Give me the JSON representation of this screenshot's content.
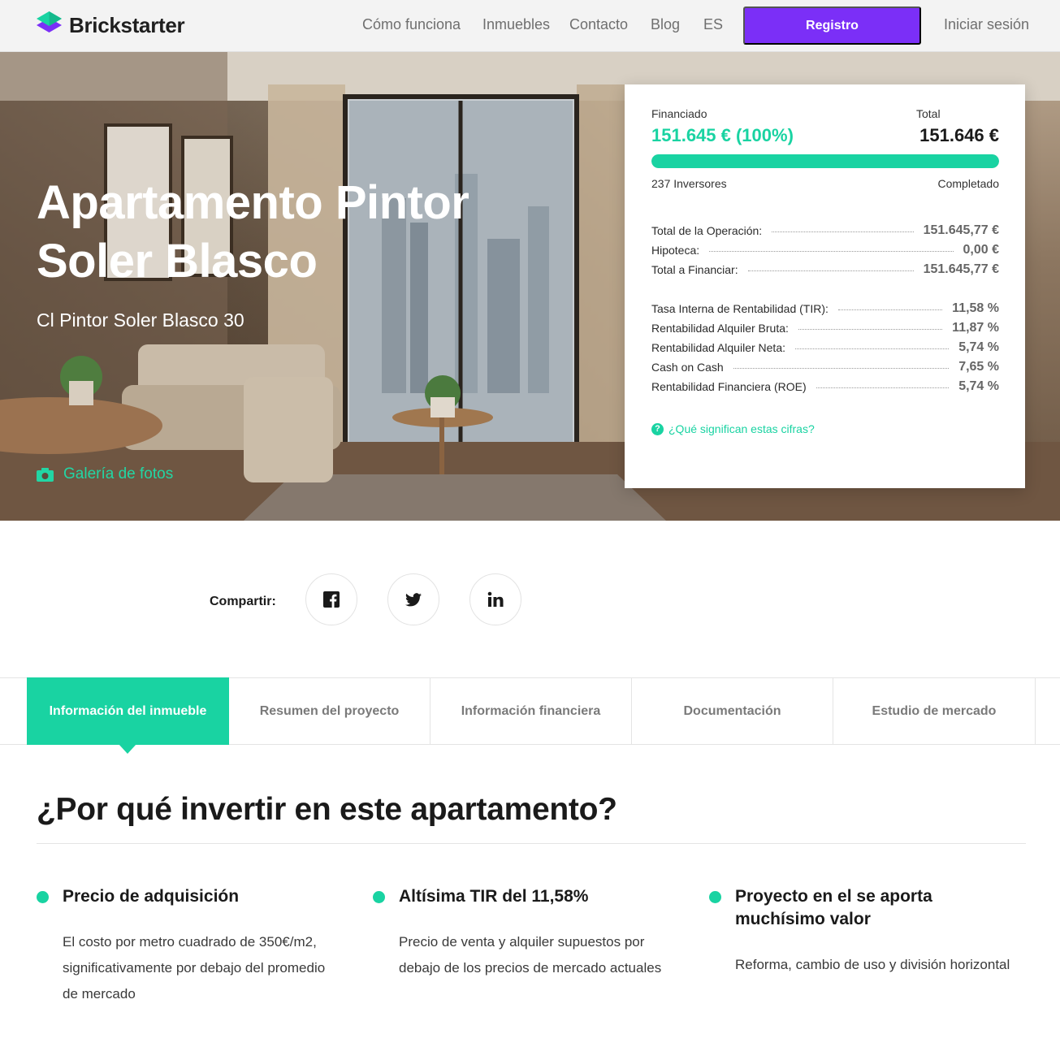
{
  "brand": {
    "name": "Brickstarter",
    "accent": "#19d3a2",
    "cta": "#7b2ff7"
  },
  "nav": {
    "items": [
      "Cómo funciona",
      "Inmuebles",
      "Contacto",
      "Blog",
      "ES"
    ],
    "register": "Registro",
    "login": "Iniciar sesión"
  },
  "hero": {
    "title": "Apartamento Pintor Soler Blasco",
    "address": "Cl Pintor Soler Blasco 30",
    "gallery": "Galería de fotos"
  },
  "funding": {
    "funded_label": "Financiado",
    "funded_value": "151.645 € (100%)",
    "total_label": "Total",
    "total_value": "151.646 €",
    "progress_fraction": 1.0,
    "investors": "237 Inversores",
    "status": "Completado",
    "operation_rows": [
      {
        "label": "Total de la Operación:",
        "value": "151.645,77 €"
      },
      {
        "label": "Hipoteca:",
        "value": "0,00 €"
      },
      {
        "label": "Total a Financiar:",
        "value": "151.645,77 €"
      }
    ],
    "return_rows": [
      {
        "label": "Tasa Interna de Rentabilidad (TIR):",
        "value": "11,58 %"
      },
      {
        "label": "Rentabilidad Alquiler Bruta:",
        "value": "11,87 %"
      },
      {
        "label": "Rentabilidad Alquiler Neta:",
        "value": "5,74 %"
      },
      {
        "label": "Cash on Cash",
        "value": "7,65 %"
      },
      {
        "label": "Rentabilidad Financiera (ROE)",
        "value": "5,74 %"
      }
    ],
    "help_icon": "?",
    "help_link": "¿Qué significan estas cifras?"
  },
  "share": {
    "label": "Compartir:",
    "icons": [
      "facebook-icon",
      "twitter-icon",
      "linkedin-icon"
    ]
  },
  "tabs": [
    "Información del inmueble",
    "Resumen del proyecto",
    "Información financiera",
    "Documentación",
    "Estudio de mercado"
  ],
  "why": {
    "title": "¿Por qué invertir en este apartamento?",
    "features": [
      {
        "title": "Precio de adquisición",
        "text": "El costo por metro cuadrado de 350€/m2, significativamente por debajo del promedio de mercado"
      },
      {
        "title": "Altísima TIR del 11,58%",
        "text": "Precio de venta y alquiler supuestos por debajo de los precios de mercado actuales"
      },
      {
        "title": "Proyecto en el se aporta muchísimo valor",
        "text": "Reforma, cambio de uso y división horizontal"
      }
    ]
  }
}
